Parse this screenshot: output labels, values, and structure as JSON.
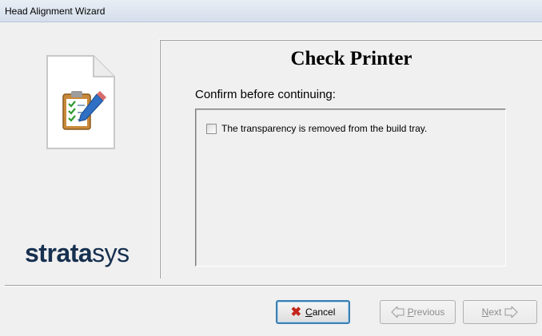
{
  "window": {
    "title": "Head Alignment Wizard"
  },
  "sidebar": {
    "icon": "checklist-document-icon",
    "brand_bold": "strata",
    "brand_light": "sys"
  },
  "page": {
    "title": "Check Printer",
    "instruction": "Confirm before continuing:",
    "checklist": [
      {
        "label": "The transparency is removed from the build tray.",
        "checked": false
      }
    ]
  },
  "buttons": {
    "cancel": {
      "mnemonic": "C",
      "rest": "ancel",
      "icon": "x-icon",
      "enabled": true
    },
    "previous": {
      "mnemonic": "P",
      "rest": "revious",
      "icon": "left-arrow-icon",
      "enabled": false
    },
    "next": {
      "mnemonic": "N",
      "rest": "ext",
      "icon": "right-arrow-icon",
      "enabled": false
    }
  },
  "colors": {
    "cancel_icon": "#c3251b",
    "brand": "#17304f",
    "default_button_border": "#3c7fb1"
  }
}
